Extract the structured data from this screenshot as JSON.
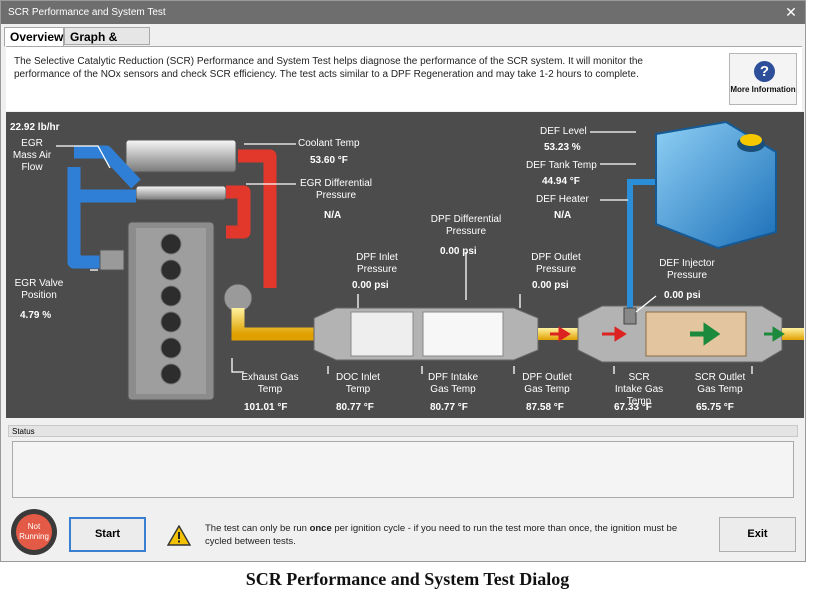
{
  "window": {
    "title": "SCR Performance and System Test",
    "close_glyph": "✕"
  },
  "tabs": [
    {
      "label": "Overview"
    },
    {
      "label": "Graph & Data"
    }
  ],
  "description": {
    "text": "The Selective Catalytic Reduction (SCR) Performance and System Test helps diagnose the performance of the SCR system. It will monitor the performance of the NOx sensors and check SCR efficiency. The test acts similar to a DPF Regeneration and may take 1-2 hours to complete.",
    "more_info_label": "More Information",
    "more_info_icon": "question-icon"
  },
  "diagram": {
    "egr_mass_air_flow": {
      "value": "22.92 lb/hr",
      "label": "EGR Mass Air Flow"
    },
    "coolant_temp": {
      "label": "Coolant Temp",
      "value": "53.60 °F"
    },
    "egr_diff_pressure": {
      "label": "EGR Differential Pressure",
      "value": "N/A"
    },
    "egr_valve_position": {
      "label": "EGR Valve Position",
      "value": "4.79 %"
    },
    "dpf_inlet_pressure": {
      "label": "DPF Inlet Pressure",
      "value": "0.00 psi"
    },
    "dpf_diff_pressure": {
      "label": "DPF Differential Pressure",
      "value": "0.00 psi"
    },
    "dpf_outlet_pressure": {
      "label": "DPF Outlet Pressure",
      "value": "0.00 psi"
    },
    "def_level": {
      "label": "DEF Level",
      "value": "53.23 %"
    },
    "def_tank_temp": {
      "label": "DEF Tank Temp",
      "value": "44.94 °F"
    },
    "def_heater": {
      "label": "DEF Heater",
      "value": "N/A"
    },
    "def_injector_pressure": {
      "label": "DEF Injector Pressure",
      "value": "0.00 psi"
    },
    "exhaust_gas_temp": {
      "label": "Exhaust Gas Temp",
      "value": "101.01 °F"
    },
    "doc_inlet_temp": {
      "label": "DOC Inlet Temp",
      "value": "80.77 °F"
    },
    "dpf_intake_gas_temp": {
      "label": "DPF Intake Gas Temp",
      "value": "80.77 °F"
    },
    "dpf_outlet_gas_temp": {
      "label": "DPF Outlet Gas Temp",
      "value": "87.58 °F"
    },
    "scr_intake_gas_temp": {
      "label": "SCR Intake Gas Temp",
      "value": "67.33 °F"
    },
    "scr_outlet_gas_temp": {
      "label": "SCR Outlet Gas Temp",
      "value": "65.75 °F"
    },
    "colors": {
      "egr_cool": "#2f7fd6",
      "egr_hot": "#e2382c",
      "exhaust": "#f0c020",
      "def_tank": "#2a8ed8",
      "background": "#4c4c4c"
    }
  },
  "status": {
    "header": "Status",
    "text": ""
  },
  "bottom": {
    "state_line1": "Not",
    "state_line2": "Running",
    "start_label": "Start",
    "warning_icon": "warning-icon",
    "notice_pre": "The test can only be run ",
    "notice_bold": "once",
    "notice_post": " per ignition cycle - if you need to run the test more than once, the ignition must be cycled between tests.",
    "exit_label": "Exit"
  },
  "caption": "SCR Performance and System Test Dialog"
}
